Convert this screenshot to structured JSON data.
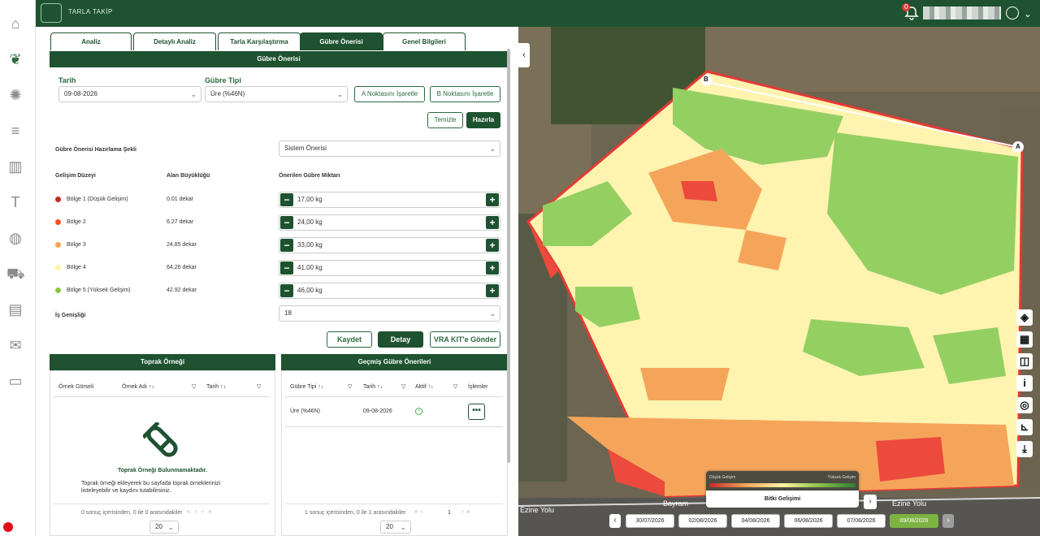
{
  "app": {
    "title": "TARLA TAKİP",
    "notif_count": "0"
  },
  "nav": [
    {
      "name": "home-icon",
      "glyph": "⌂"
    },
    {
      "name": "sprout-icon",
      "glyph": "❦"
    },
    {
      "name": "sun-icon",
      "glyph": "✺"
    },
    {
      "name": "list-add-icon",
      "glyph": "≡"
    },
    {
      "name": "chart-icon",
      "glyph": "▥"
    },
    {
      "name": "text-icon",
      "glyph": "T"
    },
    {
      "name": "palette-icon",
      "glyph": "◍"
    },
    {
      "name": "tractor-icon",
      "glyph": "⛟"
    },
    {
      "name": "chat-icon",
      "glyph": "▤"
    },
    {
      "name": "mail-icon",
      "glyph": "✉"
    },
    {
      "name": "id-card-icon",
      "glyph": "▭"
    }
  ],
  "tabs": [
    "Analiz",
    "Detaylı Analiz",
    "Tarla Karşılaştırma",
    "Gübre Önerisi",
    "Genel Bilgileri"
  ],
  "section_title": "Gübre Önerisi",
  "form": {
    "date_label": "Tarih",
    "date_value": "09-08-2026",
    "type_label": "Gübre Tipi",
    "type_value": "Üre (%46N)",
    "a_btn": "A Noktasını İşaretle",
    "b_btn": "B Noktasını İşaretle",
    "clear_btn": "Temizle",
    "prepare_btn": "Hazırla",
    "method_label": "Gübre Önerisi Hazırlama Şekli",
    "method_value": "Sistem Önerisi",
    "col1": "Gelişim Düzeyi",
    "col2": "Alan Büyüklüğü",
    "col3": "Önerilen Gübre Miktarı",
    "zones": [
      {
        "name": "Bölge 1 (Düşük Gelişim)",
        "area": "0.01 dekar",
        "qty": "17,00 kg",
        "color": "#c62828"
      },
      {
        "name": "Bölge 2",
        "area": "6.27 dekar",
        "qty": "24,00 kg",
        "color": "#f4511e"
      },
      {
        "name": "Bölge 3",
        "area": "24.85 dekar",
        "qty": "33,00 kg",
        "color": "#f5a55a"
      },
      {
        "name": "Bölge 4",
        "area": "64.26 dekar",
        "qty": "41,00 kg",
        "color": "#fff3a6"
      },
      {
        "name": "Bölge 5 (Yüksek Gelişim)",
        "area": "42.92 dekar",
        "qty": "46,00 kg",
        "color": "#8bc34a"
      }
    ],
    "width_label": "İş Genişliği",
    "width_value": "18",
    "save_btn": "Kaydet",
    "detail_btn": "Detay",
    "vra_btn": "VRA KIT'e Gönder"
  },
  "soil": {
    "title": "Toprak Örneği",
    "headers": [
      "Örnek Görseli",
      "Örnek Adı ↑↓",
      "Tarih ↑↓"
    ],
    "empty_title": "Toprak Örneği Bulunmamaktadır.",
    "empty_text": "Toprak örneği ekleyerek bu sayfada toprak örneklerinizi listeleyebilir ve kaydını tutabilirsiniz.",
    "pager": "0 sonuç içerisinden, 0 ile 0 arasındakiler",
    "page_size": "20"
  },
  "history": {
    "title": "Geçmiş Gübre Önerileri",
    "headers": [
      "Gübre Tipi ↑↓",
      "Tarih ↑↓",
      "Aktif ↑↓",
      "İşlemler"
    ],
    "row": {
      "type": "Üre (%46N)",
      "date": "09-08-2026"
    },
    "pager": "1 sonuç içerisinden, 0 ile 1 arasındakiler",
    "page": "1",
    "page_size": "20"
  },
  "map": {
    "legend_low": "Düşük Gelişim",
    "legend_high": "Yüksek Gelişim",
    "legend_title": "Bitki Gelişimi",
    "point_a": "A",
    "point_b": "B",
    "road1": "Ezine Yolu",
    "road2": "Bayram",
    "road3": "Ezine Yolu",
    "dates": [
      "30/07/2026",
      "02/08/2026",
      "04/08/2026",
      "06/08/2026",
      "07/08/2026",
      "09/08/2026"
    ],
    "tools": [
      "layers-icon",
      "map-icon",
      "split-icon",
      "info-icon",
      "locate-icon",
      "ruler-icon",
      "download-icon"
    ]
  }
}
